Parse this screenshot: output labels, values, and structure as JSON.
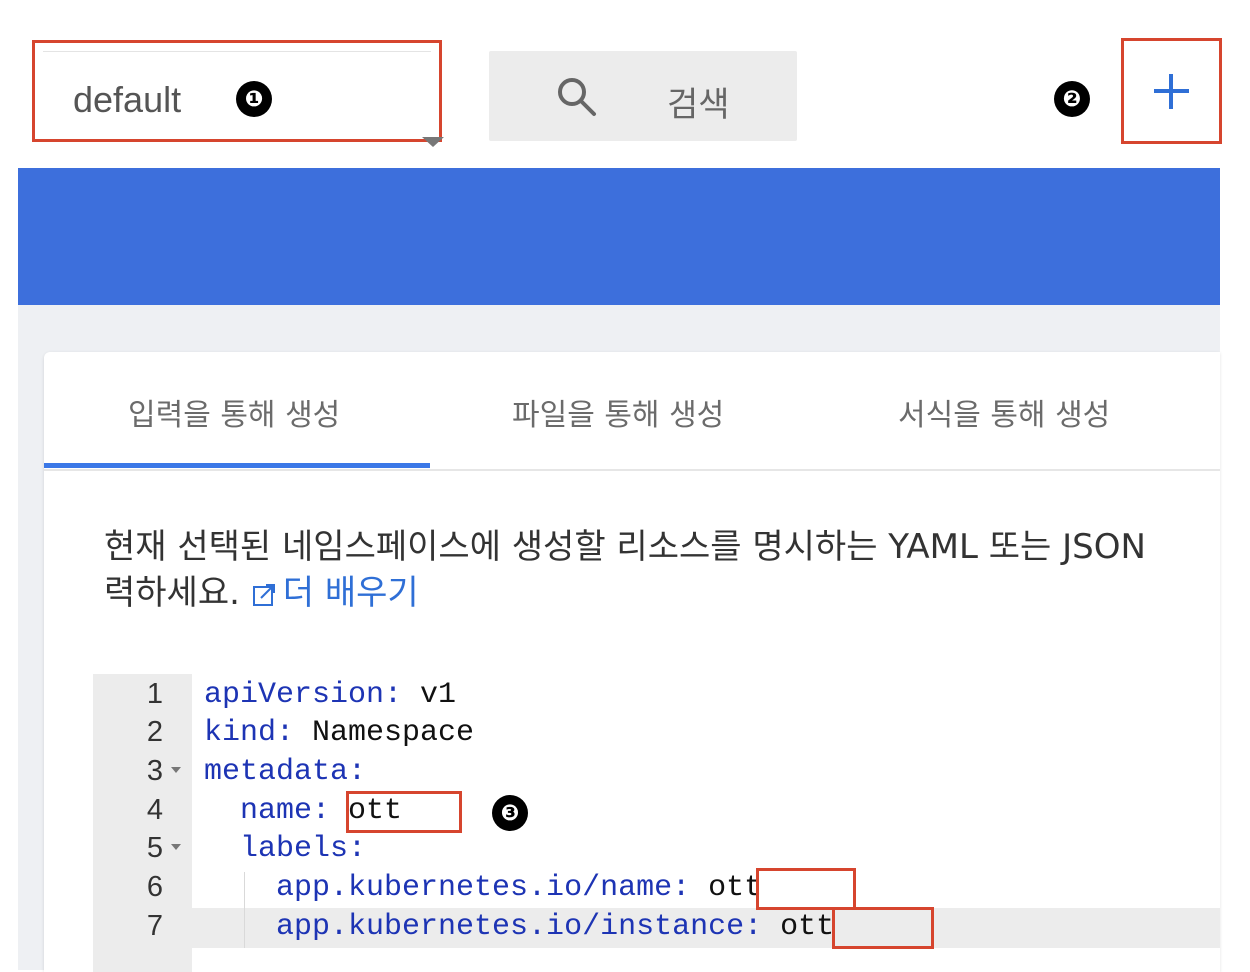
{
  "namespace_select": {
    "value": "default",
    "badge": "❶"
  },
  "search": {
    "label": "검색",
    "icon": "search-icon"
  },
  "add_button": {
    "badge": "❷",
    "icon": "plus-icon"
  },
  "tabs": [
    {
      "label": "입력을 통해 생성",
      "active": true
    },
    {
      "label": "파일을 통해 생성",
      "active": false
    },
    {
      "label": "서식을 통해 생성",
      "active": false
    }
  ],
  "description": {
    "line1": "현재 선택된 네임스페이스에 생성할 리소스를 명시하는 YAML 또는 JSON",
    "line2": "력하세요.",
    "learn_more": "더 배우기"
  },
  "editor": {
    "badge3": "❸",
    "lines": [
      {
        "n": "1",
        "key": "apiVersion:",
        "value": " v1",
        "indent": ""
      },
      {
        "n": "2",
        "key": "kind:",
        "value": " Namespace",
        "indent": ""
      },
      {
        "n": "3",
        "key": "metadata:",
        "value": "",
        "indent": ""
      },
      {
        "n": "4",
        "key": "name:",
        "value": " ott",
        "indent": "  "
      },
      {
        "n": "5",
        "key": "labels:",
        "value": "",
        "indent": "  "
      },
      {
        "n": "6",
        "key": "app.kubernetes.io/name:",
        "value": " ott",
        "indent": "    "
      },
      {
        "n": "7",
        "key": "app.kubernetes.io/instance:",
        "value": " ott",
        "indent": "    "
      }
    ]
  },
  "colors": {
    "accent": "#3d6fdc",
    "highlight_box": "#d6452e",
    "yaml_key": "#1d34b4"
  }
}
